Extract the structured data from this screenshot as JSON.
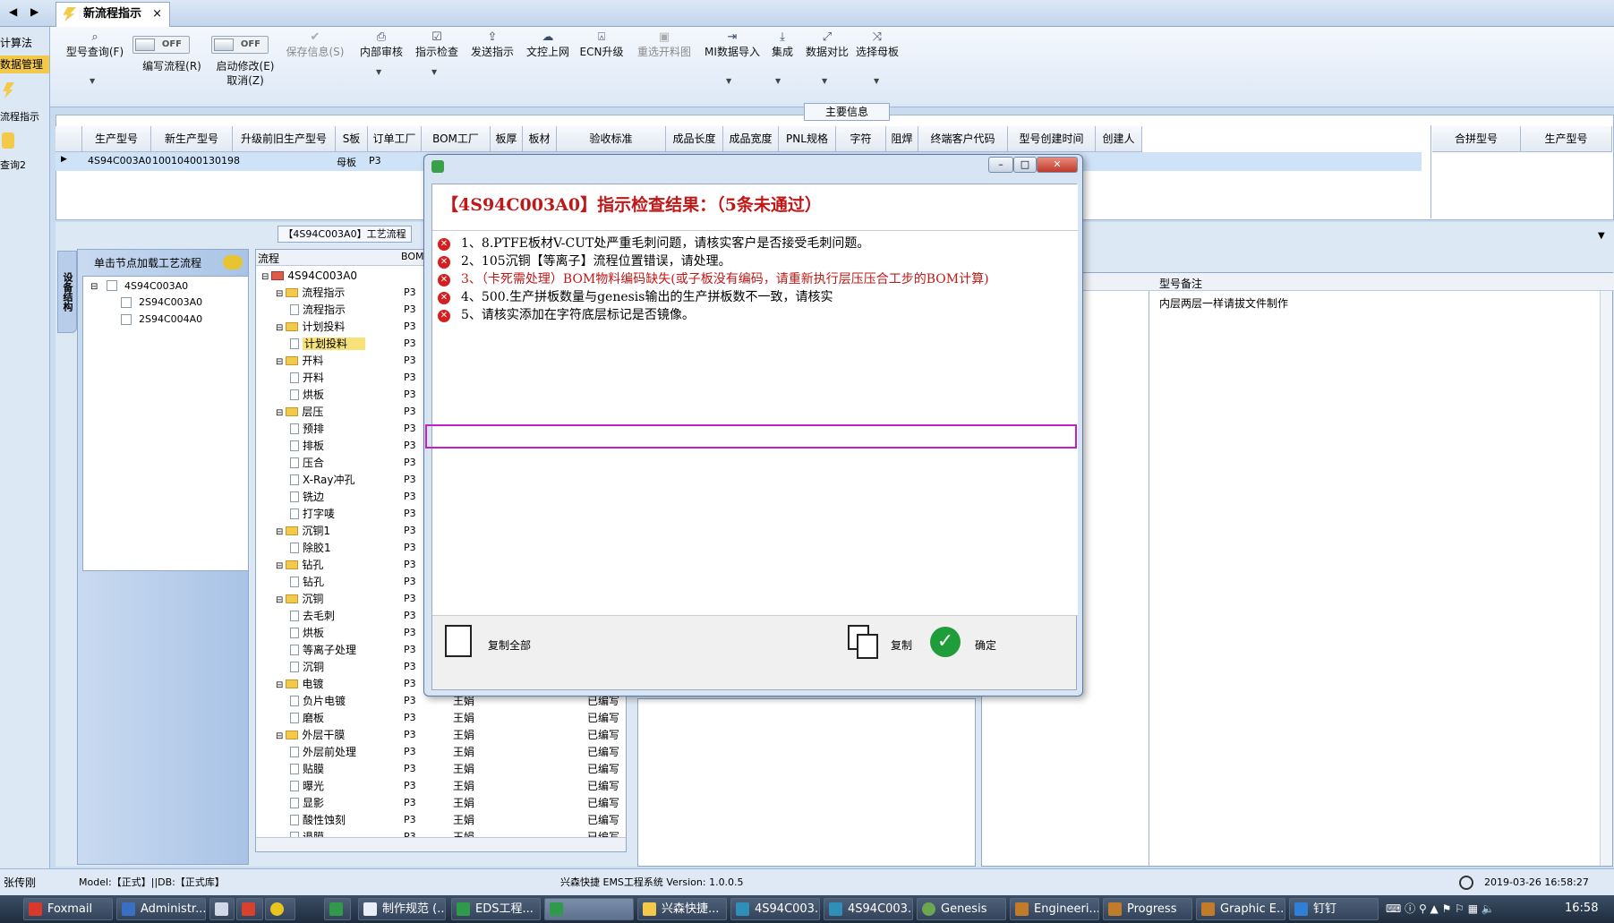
{
  "tab": {
    "title": "新流程指示",
    "close": "×"
  },
  "nav": {
    "back": "◀",
    "forward": "▶"
  },
  "left_nav": [
    "计算法",
    "数据管理",
    "流程指示",
    "查询2"
  ],
  "toolbar": {
    "items": [
      {
        "label": "型号查询(F)",
        "glyph": "search-icon",
        "enabled": true
      },
      {
        "label": "编写流程(R)",
        "toggle": "OFF",
        "enabled": true
      },
      {
        "label": "启动修改(E)",
        "sub": "取消(Z)",
        "toggle": "OFF",
        "enabled": true
      },
      {
        "label": "保存信息(S)",
        "glyph": "save-icon",
        "enabled": false
      },
      {
        "label": "内部审核",
        "glyph": "print-icon",
        "enabled": true
      },
      {
        "label": "指示检查",
        "glyph": "check-icon",
        "enabled": true
      },
      {
        "label": "发送指示",
        "glyph": "upload-icon",
        "enabled": true
      },
      {
        "label": "文控上网",
        "glyph": "cloud-icon",
        "enabled": true
      },
      {
        "label": "ECN升级",
        "glyph": "ecn-icon",
        "enabled": true
      },
      {
        "label": "重选开料图",
        "glyph": "image-icon",
        "enabled": false
      },
      {
        "label": "MI数据导入",
        "glyph": "import-icon",
        "enabled": true
      },
      {
        "label": "集成",
        "glyph": "download-icon",
        "enabled": true
      },
      {
        "label": "数据对比",
        "glyph": "compare-icon",
        "enabled": true
      },
      {
        "label": "选择母板",
        "glyph": "shuffle-icon",
        "enabled": true
      }
    ]
  },
  "main_info": {
    "label": "主要信息",
    "columns": [
      "生产型号",
      "新生产型号",
      "升级前旧生产型号",
      "S板",
      "订单工厂",
      "BOM工厂",
      "板厚",
      "板材",
      "验收标准",
      "成品长度",
      "成品宽度",
      "PNL规格",
      "字符",
      "阻焊",
      "终端客户代码",
      "型号创建时间",
      "创建人"
    ],
    "row": {
      "生产型号": "4S94C003A0",
      "新生产型号": "10010400130198",
      "S板": "母板",
      "订单工厂": "P3"
    },
    "right_columns": [
      "合拼型号",
      "生产型号"
    ]
  },
  "process_tab": "【4S94C003A0】工艺流程",
  "left_panel": {
    "vertical_tab": "设备结构",
    "header": "单击节点加载工艺流程",
    "tree": [
      "4S94C003A0",
      "2S94C003A0",
      "2S94C004A0"
    ]
  },
  "flow": {
    "header": "流程",
    "bom_header": "BOM",
    "nodes": [
      {
        "label": "4S94C003A0",
        "level": 0,
        "kind": "root",
        "f": ""
      },
      {
        "label": "流程指示",
        "level": 1,
        "kind": "folder",
        "f": "P3"
      },
      {
        "label": "流程指示",
        "level": 2,
        "kind": "doc",
        "f": "P3"
      },
      {
        "label": "计划投料",
        "level": 1,
        "kind": "folder",
        "f": "P3"
      },
      {
        "label": "计划投料",
        "level": 2,
        "kind": "doc",
        "f": "P3",
        "selected": true
      },
      {
        "label": "开料",
        "level": 1,
        "kind": "folder",
        "f": "P3"
      },
      {
        "label": "开料",
        "level": 2,
        "kind": "doc",
        "f": "P3"
      },
      {
        "label": "烘板",
        "level": 2,
        "kind": "doc",
        "f": "P3"
      },
      {
        "label": "层压",
        "level": 1,
        "kind": "folder",
        "f": "P3"
      },
      {
        "label": "预排",
        "level": 2,
        "kind": "doc",
        "f": "P3"
      },
      {
        "label": "排板",
        "level": 2,
        "kind": "doc",
        "f": "P3"
      },
      {
        "label": "压合",
        "level": 2,
        "kind": "doc",
        "f": "P3"
      },
      {
        "label": "X-Ray冲孔",
        "level": 2,
        "kind": "doc",
        "f": "P3"
      },
      {
        "label": "铣边",
        "level": 2,
        "kind": "doc",
        "f": "P3"
      },
      {
        "label": "打字唛",
        "level": 2,
        "kind": "doc",
        "f": "P3"
      },
      {
        "label": "沉铜1",
        "level": 1,
        "kind": "folder",
        "f": "P3"
      },
      {
        "label": "除胶1",
        "level": 2,
        "kind": "doc",
        "f": "P3"
      },
      {
        "label": "钻孔",
        "level": 1,
        "kind": "folder",
        "f": "P3"
      },
      {
        "label": "钻孔",
        "level": 2,
        "kind": "doc",
        "f": "P3"
      },
      {
        "label": "沉铜",
        "level": 1,
        "kind": "folder",
        "f": "P3"
      },
      {
        "label": "去毛刺",
        "level": 2,
        "kind": "doc",
        "f": "P3"
      },
      {
        "label": "烘板",
        "level": 2,
        "kind": "doc",
        "f": "P3"
      },
      {
        "label": "等离子处理",
        "level": 2,
        "kind": "doc",
        "f": "P3"
      },
      {
        "label": "沉铜",
        "level": 2,
        "kind": "doc",
        "f": "P3"
      },
      {
        "label": "电镀",
        "level": 1,
        "kind": "folder",
        "f": "P3"
      },
      {
        "label": "负片电镀",
        "level": 2,
        "kind": "doc",
        "f": "P3",
        "u": "王娟",
        "s": "已编写"
      },
      {
        "label": "磨板",
        "level": 2,
        "kind": "doc",
        "f": "P3",
        "u": "王娟",
        "s": "已编写"
      },
      {
        "label": "外层干膜",
        "level": 1,
        "kind": "folder",
        "f": "P3",
        "u": "王娟",
        "s": "已编写"
      },
      {
        "label": "外层前处理",
        "level": 2,
        "kind": "doc",
        "f": "P3",
        "u": "王娟",
        "s": "已编写"
      },
      {
        "label": "贴膜",
        "level": 2,
        "kind": "doc",
        "f": "P3",
        "u": "王娟",
        "s": "已编写"
      },
      {
        "label": "曝光",
        "level": 2,
        "kind": "doc",
        "f": "P3",
        "u": "王娟",
        "s": "已编写"
      },
      {
        "label": "显影",
        "level": 2,
        "kind": "doc",
        "f": "P3",
        "u": "王娟",
        "s": "已编写"
      },
      {
        "label": "酸性蚀刻",
        "level": 2,
        "kind": "doc",
        "f": "P3",
        "u": "王娟",
        "s": "已编写"
      },
      {
        "label": "退膜",
        "level": 2,
        "kind": "doc",
        "f": "P3",
        "u": "王娟",
        "s": "已编写"
      }
    ]
  },
  "right_panel": {
    "header": "型号备注",
    "note": "内层两层一样请拔文件制作"
  },
  "dialog": {
    "title": "【4S94C003A0】指示检查结果：（5条未通过）",
    "messages": [
      "1、8.PTFE板材V-CUT处严重毛刺问题，请核实客户是否接受毛刺问题。",
      "2、105沉铜【等离子】流程位置错误，请处理。",
      "3、（卡死需处理）BOM物料编码缺失(或子板没有编码，请重新执行层压压合工步的BOM计算)",
      "4、500.生产拼板数量与genesis输出的生产拼板数不一致，请核实",
      "5、请核实添加在字符底层标记是否镜像。"
    ],
    "copy_all": "复制全部",
    "copy": "复制",
    "ok": "确定"
  },
  "status": {
    "user": "张传刚",
    "model": "Model:【正式】||DB:【正式库】",
    "app": "兴森快捷 EMS工程系统 Version: 1.0.0.5",
    "datetime": "2019-03-26 16:58:27"
  },
  "taskbar": {
    "items": [
      "Foxmail",
      "Administr...",
      "",
      "",
      "",
      "",
      "制作规范 (...",
      "EDS工程...",
      "",
      "兴森快捷...",
      "4S94C003...",
      "4S94C003...",
      "Genesis",
      "Engineeri...",
      "Progress",
      "Graphic E...",
      "钉钉"
    ],
    "clock": "16:58"
  },
  "colors": {
    "error": "#d42020",
    "highlight": "#c020c8",
    "accent": "#f3c94a"
  }
}
